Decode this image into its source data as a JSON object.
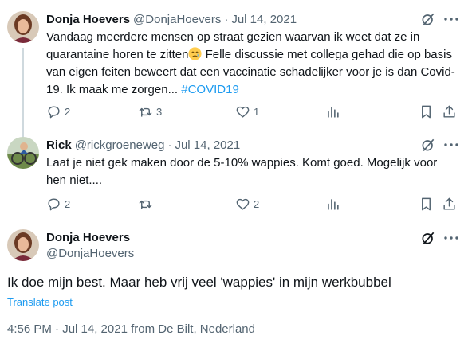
{
  "tweets": [
    {
      "name": "Donja Hoevers",
      "handle": "@DonjaHoevers",
      "separator": "·",
      "date": "Jul 14, 2021",
      "text_part1": "Vandaag meerdere mensen op straat gezien waarvan ik weet dat ze in quarantaine horen te zitten",
      "emoji": "crying-face-emoji",
      "text_part2": " Felle discussie met collega gehad die op basis van eigen feiten beweert dat een vaccinatie schadelijker voor je is dan Covid-19. Ik maak me zorgen... ",
      "hashtag": "#COVID19",
      "replies": "2",
      "retweets": "3",
      "likes": "1"
    },
    {
      "name": "Rick",
      "handle": "@rickgroeneweg",
      "separator": "·",
      "date": "Jul 14, 2021",
      "text": "Laat je niet gek maken door de 5-10% wappies. Komt goed. Mogelijk voor hen niet....",
      "replies": "2",
      "retweets": "",
      "likes": "2"
    }
  ],
  "main_tweet": {
    "name": "Donja Hoevers",
    "handle": "@DonjaHoevers",
    "text": "Ik doe mijn best. Maar heb vrij veel 'wappies' in mijn werkbubbel",
    "translate": "Translate post",
    "meta": "4:56 PM · Jul 14, 2021 from De Bilt, Nederland"
  },
  "icons": {
    "reply": "reply-icon",
    "retweet": "retweet-icon",
    "like": "heart-icon",
    "views": "analytics-icon",
    "bookmark": "bookmark-icon",
    "share": "share-icon",
    "grok": "grok-icon",
    "more": "more-icon"
  },
  "colors": {
    "text": "#0f1419",
    "secondary": "#536471",
    "link": "#1d9bf0",
    "thread_line": "#cfd9de"
  }
}
